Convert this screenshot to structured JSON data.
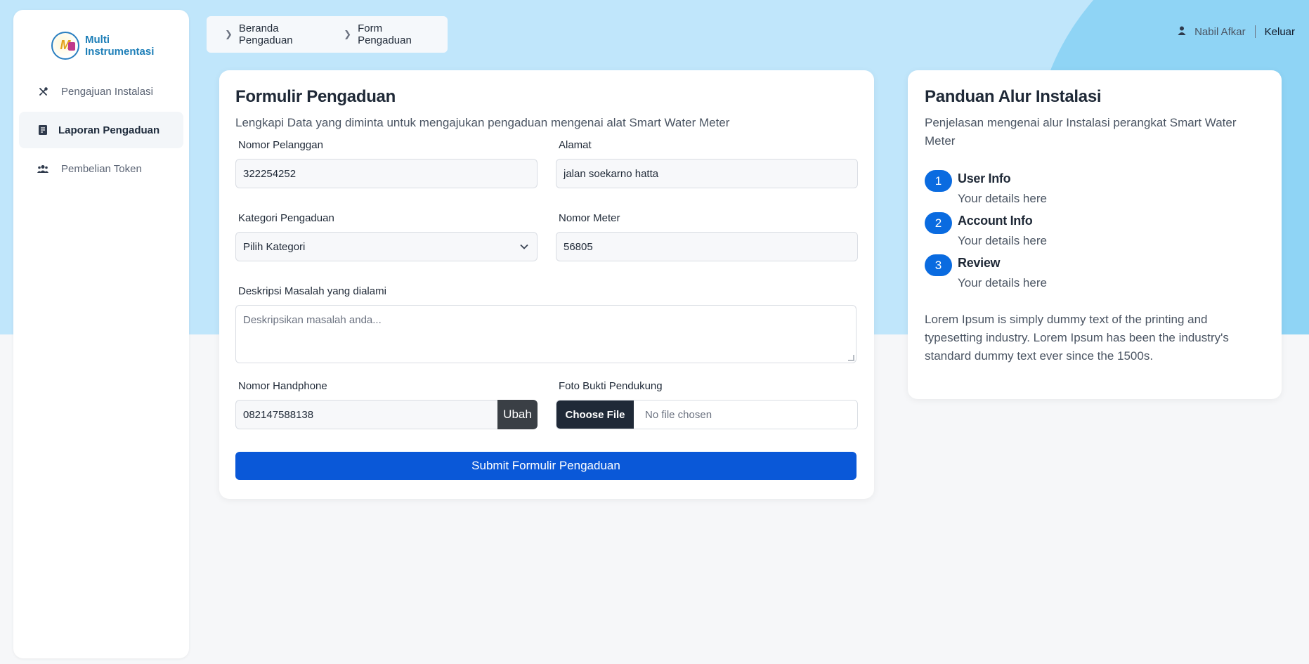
{
  "app": {
    "logo_line1": "Multi",
    "logo_line2": "Instrumentasi",
    "logo_icon": "globe-logo-icon"
  },
  "sidebar": {
    "items": [
      {
        "label": "Pengajuan Instalasi",
        "icon": "tools-icon",
        "active": false
      },
      {
        "label": "Laporan Pengaduan",
        "icon": "document-icon",
        "active": true
      },
      {
        "label": "Pembelian Token",
        "icon": "users-icon",
        "active": false
      }
    ]
  },
  "breadcrumb": {
    "items": [
      "Beranda Pengaduan",
      "Form Pengaduan"
    ]
  },
  "header": {
    "username": "Nabil Afkar",
    "logout_label": "Keluar",
    "user_icon": "user-icon"
  },
  "form": {
    "title": "Formulir Pengaduan",
    "subtitle": "Lengkapi Data yang diminta untuk mengajukan pengaduan mengenai alat Smart Water Meter",
    "customer_number": {
      "label": "Nomor Pelanggan",
      "value": "322254252"
    },
    "address": {
      "label": "Alamat",
      "value": "jalan soekarno hatta"
    },
    "category": {
      "label": "Kategori Pengaduan",
      "selected": "Pilih Kategori"
    },
    "meter_number": {
      "label": "Nomor Meter",
      "value": "56805"
    },
    "description": {
      "label": "Deskripsi Masalah yang dialami",
      "placeholder": "Deskripsikan masalah anda..."
    },
    "phone": {
      "label": "Nomor Handphone",
      "value": "082147588138",
      "change_label": "Ubah"
    },
    "photo": {
      "label": "Foto Bukti Pendukung",
      "choose_label": "Choose File",
      "status": "No file chosen"
    },
    "submit_label": "Submit Formulir Pengaduan"
  },
  "guide": {
    "title": "Panduan Alur Instalasi",
    "subtitle": "Penjelasan mengenai alur Instalasi perangkat Smart Water Meter",
    "steps": [
      {
        "number": "1",
        "title": "User Info",
        "desc": "Your details here"
      },
      {
        "number": "2",
        "title": "Account Info",
        "desc": "Your details here"
      },
      {
        "number": "3",
        "title": "Review",
        "desc": "Your details here"
      }
    ],
    "body": "Lorem Ipsum is simply dummy text of the printing and typesetting industry. Lorem Ipsum has been the industry's standard dummy text ever since the 1500s."
  },
  "colors": {
    "primary": "#0a58d8",
    "step_badge": "#0a6be0",
    "hero_bg": "#c0e6fb",
    "logo_text": "#1e7fb8"
  }
}
